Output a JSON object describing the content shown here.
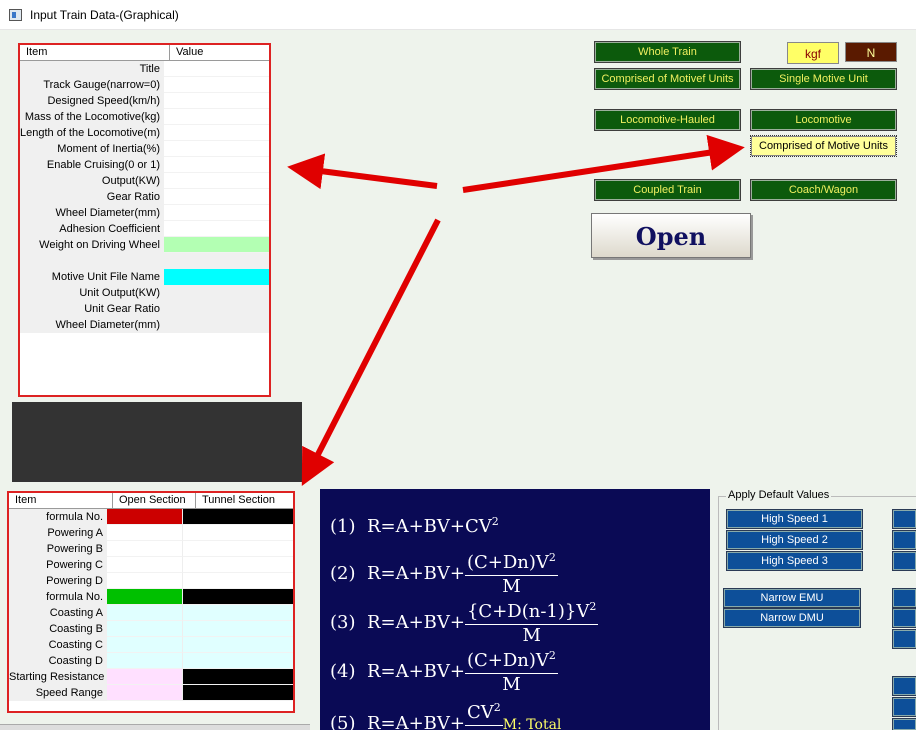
{
  "window": {
    "title": "Input Train Data-(Graphical)"
  },
  "train_grid": {
    "headers": [
      "Item",
      "Value"
    ],
    "rows": [
      "Title",
      "Track Gauge(narrow=0)",
      "Designed Speed(km/h)",
      "Mass of the Locomotive(kg)",
      "Length of the Locomotive(m)",
      "Moment of Inertia(%)",
      "Enable Cruising(0 or 1)",
      "Output(KW)",
      "Gear Ratio",
      "Wheel Diameter(mm)",
      "Adhesion Coefficient",
      "Weight on Driving Wheel",
      "",
      "Motive Unit File Name",
      "Unit Output(KW)",
      "Unit Gear Ratio",
      "Wheel Diameter(mm)"
    ],
    "colors": {
      "weight_on_driving_wheel": "#b3ffb3",
      "motive_unit_file_name": "#00ffff"
    }
  },
  "buttons": {
    "whole_train": "Whole Train",
    "kgf": "kgf",
    "n": "N",
    "comprised_of_motive_units": "Comprised of Motivef Units",
    "single_motive_unit": "Single Motive Unit",
    "locomotive_hauled": "Locomotive-Hauled",
    "locomotive": "Locomotive",
    "comprised_of_motive_units_2": "Comprised of Motive Units",
    "coupled_train": "Coupled Train",
    "coach_wagon": "Coach/Wagon",
    "open": "Open"
  },
  "resistance_grid": {
    "headers": [
      "Item",
      "Open Section",
      "Tunnel Section"
    ],
    "rows": [
      "formula No.",
      "Powering A",
      "Powering B",
      "Powering C",
      "Powering D",
      "formula No.",
      "Coasting A",
      "Coasting B",
      "Coasting C",
      "Coasting D",
      "Starting Resistance",
      "Speed Range"
    ],
    "colors": {
      "red": "#cc0000",
      "green": "#00c000",
      "black": "#000000",
      "cyan": "#e0ffff",
      "pink": "#ffe0ff"
    }
  },
  "formulas": {
    "f1": {
      "num": "(1)",
      "lhs": "R=A+BV+CV",
      "exp": "2"
    },
    "f2": {
      "num": "(2)",
      "lhs": "R=A+BV+",
      "top": "(C+Dn)V",
      "exp": "2",
      "bottom": "M"
    },
    "f3": {
      "num": "(3)",
      "lhs": "R=A+BV+",
      "top": "{C+D(n-1)}V",
      "exp": "2",
      "bottom": "M"
    },
    "f4": {
      "num": "(4)",
      "lhs": "R=A+BV+",
      "top": "(C+Dn)V",
      "exp": "2",
      "bottom": "M"
    },
    "f5": {
      "num": "(5)",
      "lhs": "R=A+BV+",
      "top": "CV",
      "exp": "2",
      "suffix": "M: Total"
    }
  },
  "defaults": {
    "group_title": "Apply Default Values",
    "buttons": [
      "High Speed 1",
      "High Speed 2",
      "High Speed 3",
      "Narrow EMU",
      "Narrow DMU"
    ]
  }
}
